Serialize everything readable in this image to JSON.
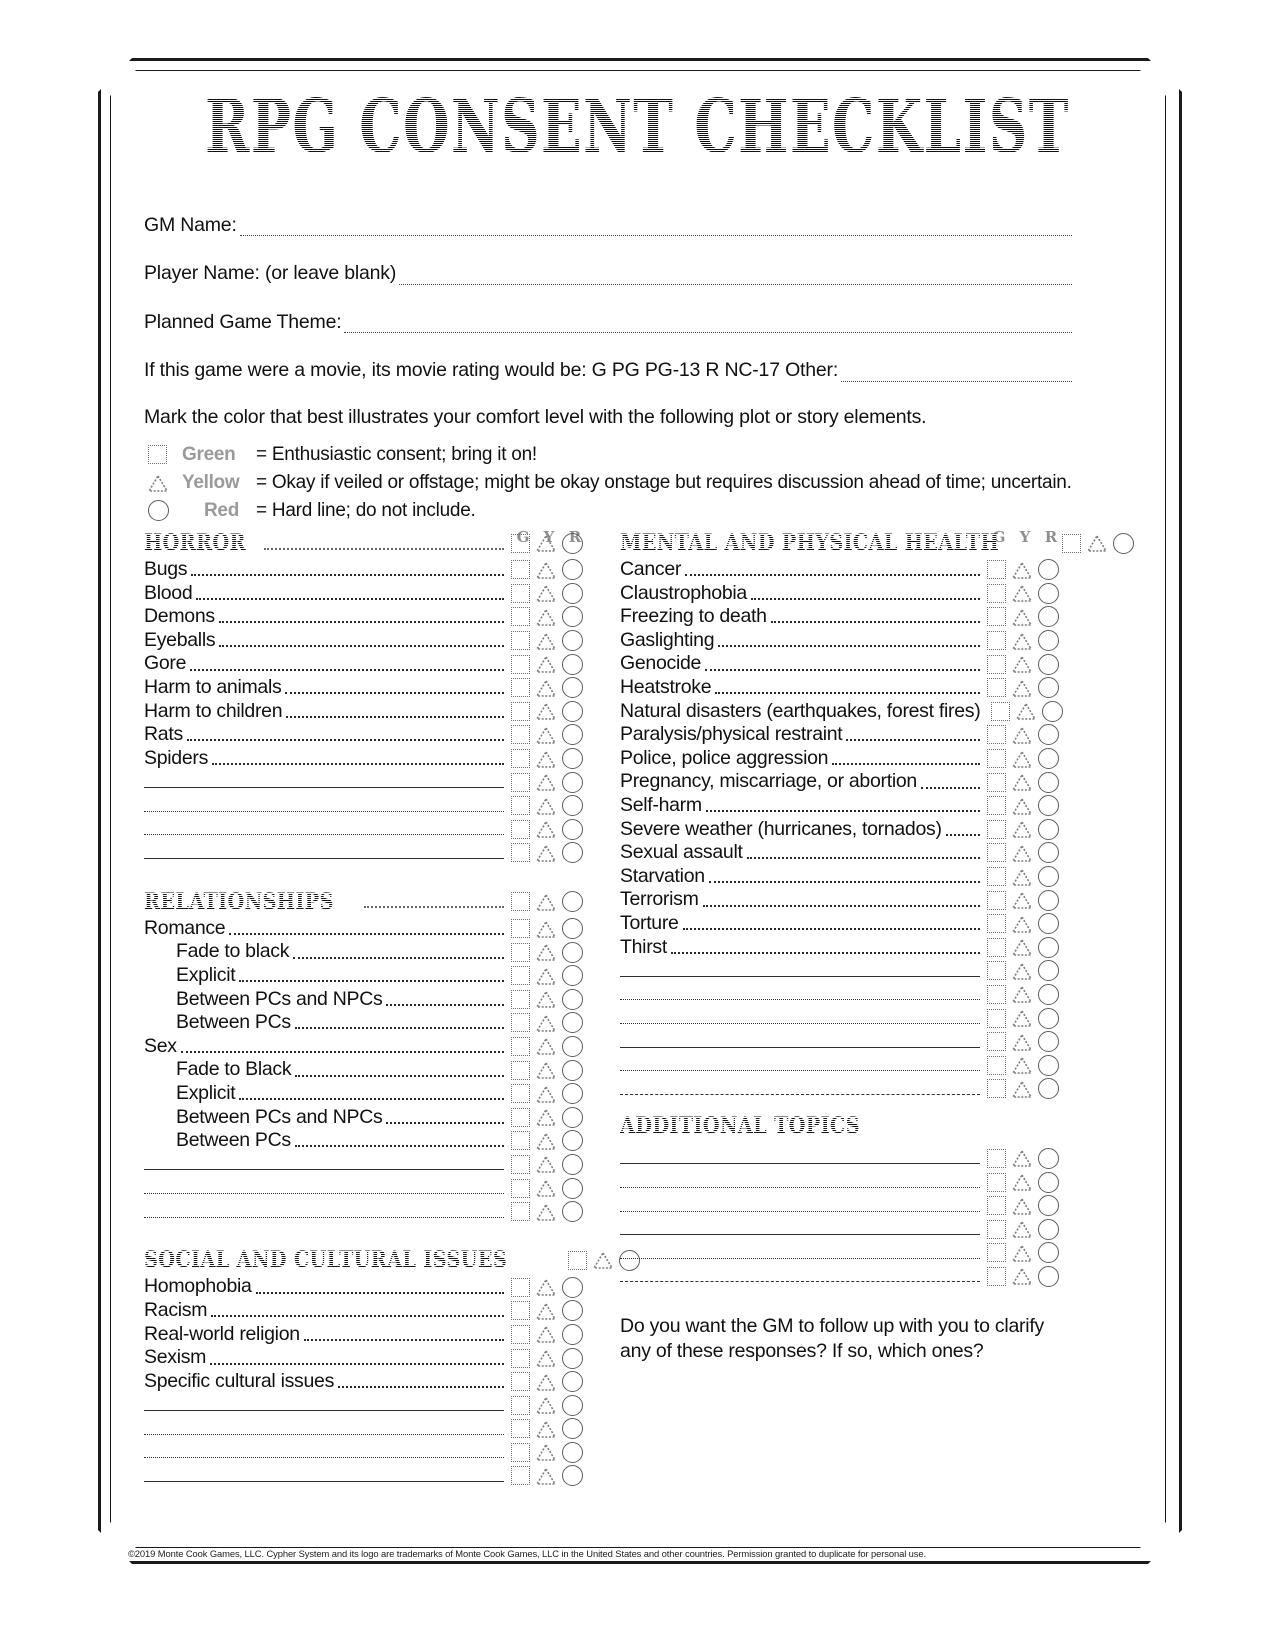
{
  "title": "RPG CONSENT CHECKLIST",
  "fields": [
    {
      "label": "GM Name:"
    },
    {
      "label": "Player Name: (or leave blank)"
    },
    {
      "label": "Planned Game Theme:"
    },
    {
      "label": "If this game were a movie, its movie rating would be: G PG PG-13 R NC-17 Other:"
    }
  ],
  "instruction": "Mark the color that best illustrates your comfort level with the following plot or story elements.",
  "legend": [
    {
      "symbol": "square",
      "word": "Green",
      "text": "= Enthusiastic consent; bring it on!"
    },
    {
      "symbol": "triangle",
      "word": "Yellow",
      "text": "= Okay if veiled or offstage; might be okay onstage but requires discussion ahead of time; uncertain."
    },
    {
      "symbol": "circle",
      "word": "Red",
      "text": "= Hard line; do not include."
    }
  ],
  "column_headers": [
    "G",
    "Y",
    "R"
  ],
  "sections": {
    "horror": {
      "heading": "HORROR",
      "items": [
        "Bugs",
        "Blood",
        "Demons",
        "Eyeballs",
        "Gore",
        "Harm to animals",
        "Harm to children",
        "Rats",
        "Spiders"
      ],
      "blank_lines": 4
    },
    "relationships": {
      "heading": "RELATIONSHIPS",
      "items": [
        {
          "label": "Romance",
          "indent": false
        },
        {
          "label": "Fade to black",
          "indent": true
        },
        {
          "label": "Explicit",
          "indent": true
        },
        {
          "label": "Between PCs and NPCs",
          "indent": true
        },
        {
          "label": "Between PCs",
          "indent": true
        },
        {
          "label": "Sex",
          "indent": false
        },
        {
          "label": "Fade to Black",
          "indent": true
        },
        {
          "label": "Explicit",
          "indent": true
        },
        {
          "label": "Between PCs and NPCs",
          "indent": true
        },
        {
          "label": "Between PCs",
          "indent": true
        }
      ],
      "blank_lines": 3
    },
    "social": {
      "heading": "SOCIAL AND CULTURAL ISSUES",
      "items": [
        "Homophobia",
        "Racism",
        "Real-world religion",
        "Sexism",
        "Specific cultural issues"
      ],
      "blank_lines": 4
    },
    "health": {
      "heading": "MENTAL AND PHYSICAL HEALTH",
      "items": [
        {
          "label": "Cancer",
          "leader": true
        },
        {
          "label": "Claustrophobia",
          "leader": true
        },
        {
          "label": "Freezing to death",
          "leader": true
        },
        {
          "label": "Gaslighting",
          "leader": true
        },
        {
          "label": "Genocide",
          "leader": true
        },
        {
          "label": "Heatstroke",
          "leader": true
        },
        {
          "label": "Natural disasters (earthquakes, forest fires)",
          "leader": false
        },
        {
          "label": "Paralysis/physical restraint",
          "leader": true
        },
        {
          "label": "Police, police aggression",
          "leader": true
        },
        {
          "label": "Pregnancy, miscarriage, or abortion",
          "leader": true
        },
        {
          "label": "Self-harm",
          "leader": true
        },
        {
          "label": "Severe weather (hurricanes, tornados)",
          "leader": true
        },
        {
          "label": "Sexual assault",
          "leader": true
        },
        {
          "label": "Starvation",
          "leader": true
        },
        {
          "label": "Terrorism",
          "leader": true
        },
        {
          "label": "Torture",
          "leader": true
        },
        {
          "label": "Thirst",
          "leader": true
        }
      ],
      "blank_lines": 6
    },
    "additional": {
      "heading": "ADDITIONAL TOPICS",
      "blank_lines": 6
    }
  },
  "followup_question": "Do you want the GM to follow up with you to clarify any of these responses? If so, which ones?",
  "footer": "©2019 Monte Cook Games, LLC. Cypher System and its logo are trademarks of Monte Cook Games, LLC in the United States and other countries. Permission granted to duplicate for personal use."
}
